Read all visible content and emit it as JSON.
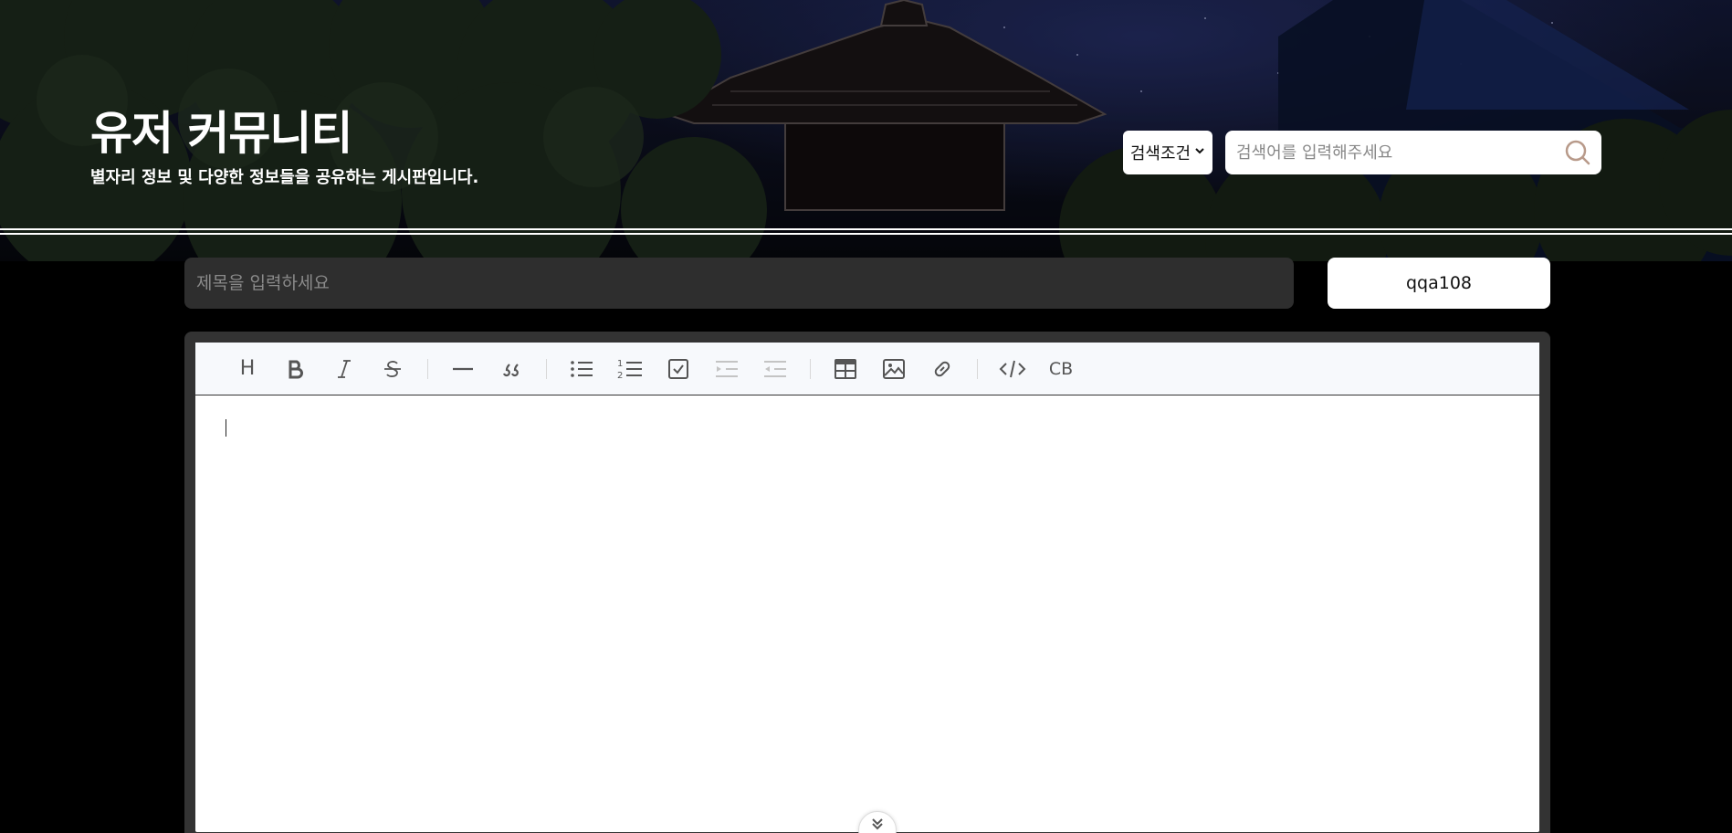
{
  "header": {
    "title": "유저 커뮤니티",
    "subtitle": "별자리 정보 및 다양한 정보들을 공유하는 게시판입니다."
  },
  "search": {
    "condition_label": "검색조건",
    "placeholder": "검색어를 입력해주세요"
  },
  "post": {
    "title_placeholder": "제목을 입력하세요",
    "author": "qqa108"
  },
  "toolbar": {
    "heading": "H",
    "codeblock": "CB",
    "buttons": [
      "heading",
      "bold",
      "italic",
      "strike",
      "hr",
      "quote",
      "bullet-list",
      "ordered-list",
      "task-list",
      "indent",
      "outdent",
      "table",
      "image",
      "link",
      "code",
      "codeblock"
    ]
  },
  "colors": {
    "background": "#000000",
    "title_bar": "#2e2e2e",
    "editor_frame": "#333333",
    "toolbar_bg": "#f7f9fc",
    "search_icon": "#b89a8a"
  }
}
